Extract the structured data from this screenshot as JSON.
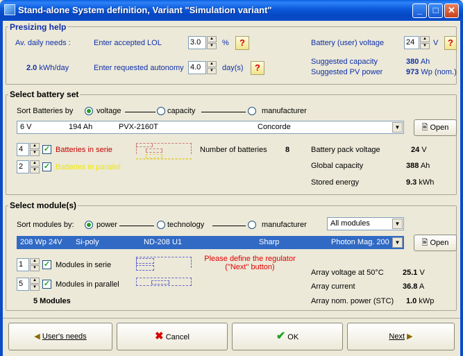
{
  "window": {
    "title": "Stand-alone System definition, Variant  \"Simulation variant\"",
    "minimize": "_",
    "maximize": "□",
    "close": "✕"
  },
  "presizing": {
    "label": "Presizing help",
    "av_daily_needs_label": "Av. daily needs :",
    "lol_label": "Enter accepted LOL",
    "lol_value": "3.0",
    "lol_unit": "%",
    "daily_value": "2.0",
    "daily_unit": "kWh/day",
    "autonomy_label": "Enter requested autonomy",
    "autonomy_value": "4.0",
    "autonomy_unit": "day(s)",
    "voltage_label": "Battery (user) voltage",
    "voltage_value": "24",
    "voltage_unit": "V",
    "sugg_cap_label": "Suggested capacity",
    "sugg_cap_value": "380",
    "sugg_cap_unit": "Ah",
    "sugg_pv_label": "Suggested PV power",
    "sugg_pv_value": "973",
    "sugg_pv_unit": "Wp (nom.)",
    "help": "?"
  },
  "battery": {
    "label": "Select battery set",
    "sort_label": "Sort Batteries by",
    "sort_voltage": "voltage",
    "sort_capacity": "capacity",
    "sort_manufacturer": "manufacturer",
    "selected_voltage": "6 V",
    "selected_capacity": "194 Ah",
    "selected_model": "PVX-2160T",
    "selected_maker": "Concorde",
    "open": "Open",
    "serie_value": "4",
    "serie_label": "Batteries in serie",
    "parallel_value": "2",
    "parallel_label": "Batteries in parallel",
    "num_label": "Number of batteries",
    "num_value": "8",
    "pack_voltage_label": "Battery pack voltage",
    "pack_voltage_value": "24",
    "pack_voltage_unit": "V",
    "global_cap_label": "Global capacity",
    "global_cap_value": "388",
    "global_cap_unit": "Ah",
    "stored_label": "Stored energy",
    "stored_value": "9.3",
    "stored_unit": "kWh"
  },
  "modules": {
    "label": "Select module(s)",
    "sort_label": "Sort modules by:",
    "sort_power": "power",
    "sort_technology": "technology",
    "sort_manufacturer": "manufacturer",
    "filter": "All modules",
    "selected_power": "208 Wp 24V",
    "selected_tech": "Si-poly",
    "selected_model": "ND-208 U1",
    "selected_maker": "Sharp",
    "selected_source": "Photon Mag. 200",
    "open": "Open",
    "serie_value": "1",
    "serie_label": "Modules in serie",
    "parallel_value": "5",
    "parallel_label": "Modules in parallel",
    "count_text": "5  Modules",
    "warning_line1": "Please define the regulator",
    "warning_line2": "(\"Next\" button)",
    "array_voltage_label": "Array voltage at 50°C",
    "array_voltage_value": "25.1",
    "array_voltage_unit": "V",
    "array_current_label": "Array current",
    "array_current_value": "36.8",
    "array_current_unit": "A",
    "array_power_label": "Array nom. power (STC)",
    "array_power_value": "1.0",
    "array_power_unit": "kWp"
  },
  "buttons": {
    "users_needs": "User's needs",
    "cancel": "Cancel",
    "ok": "OK",
    "next": "Next"
  }
}
